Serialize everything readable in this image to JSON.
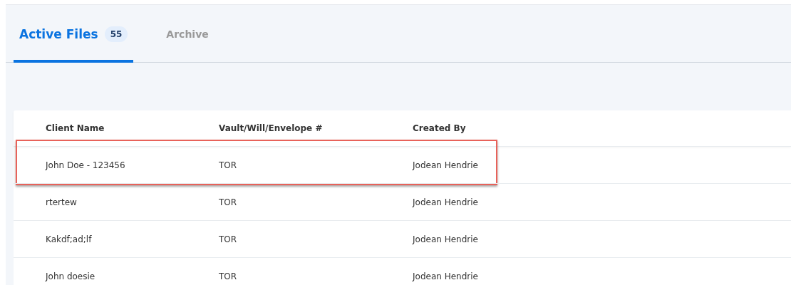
{
  "tabs": [
    {
      "label": "Active Files",
      "count": "55",
      "selected": true
    },
    {
      "label": "Archive",
      "selected": false
    }
  ],
  "table": {
    "columns": [
      "Client Name",
      "Vault/Will/Envelope #",
      "Created By"
    ],
    "rows": [
      {
        "cells": [
          "John Doe - 123456",
          "TOR",
          "Jodean Hendrie"
        ],
        "highlighted": true
      },
      {
        "cells": [
          "rtertew",
          "TOR",
          "Jodean Hendrie"
        ],
        "highlighted": false
      },
      {
        "cells": [
          "Kakdf;ad;lf",
          "TOR",
          "Jodean Hendrie"
        ],
        "highlighted": false
      },
      {
        "cells": [
          "John doesie",
          "TOR",
          "Jodean Hendrie"
        ],
        "highlighted": false
      }
    ]
  }
}
